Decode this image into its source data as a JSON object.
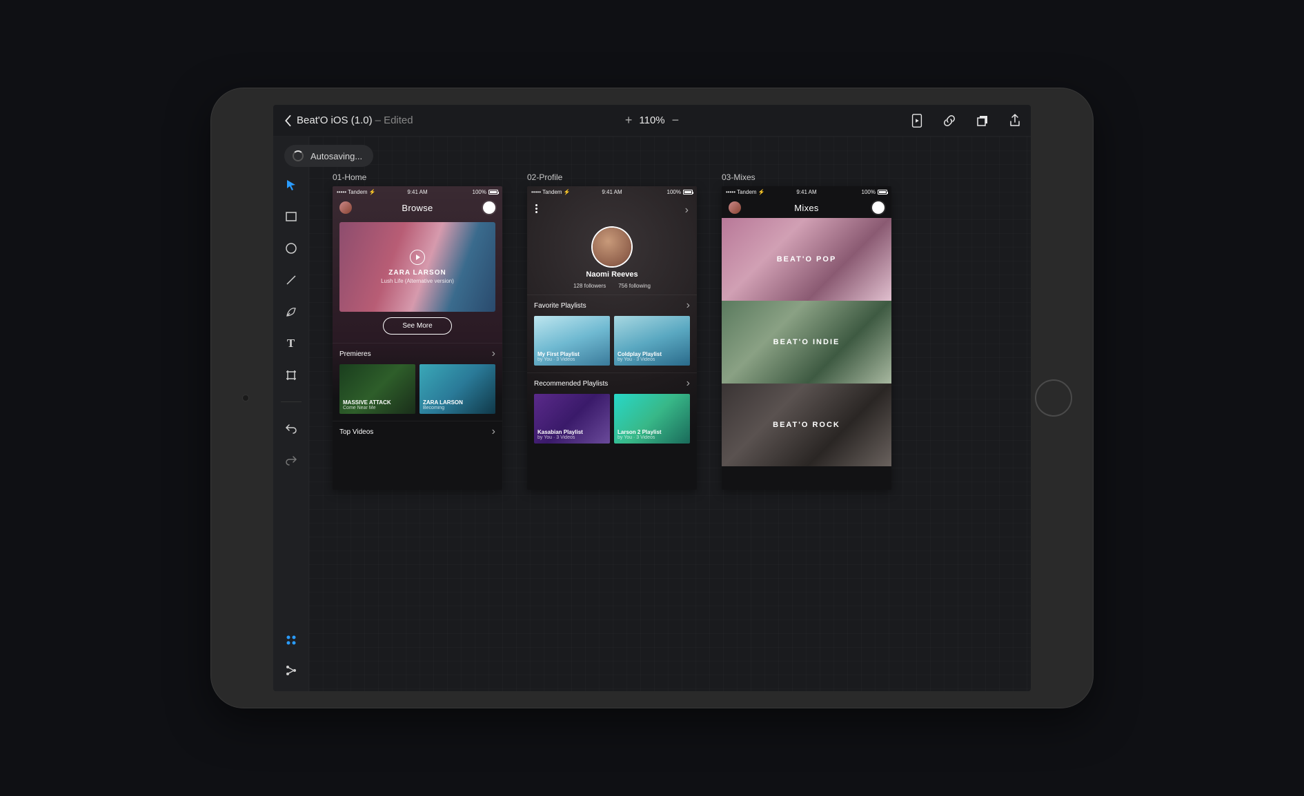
{
  "topbar": {
    "title": "Beat'O iOS (1.0)",
    "edited_suffix": " – Edited",
    "zoom": "110%"
  },
  "autosave": {
    "text": "Autosaving..."
  },
  "artboards": {
    "home": {
      "label": "01-Home",
      "status": {
        "carrier": "Tandem",
        "time": "9:41 AM",
        "battery": "100%"
      },
      "header_title": "Browse",
      "hero": {
        "artist": "ZARA LARSON",
        "track": "Lush Life (Alternative version)"
      },
      "see_more": "See More",
      "section_premieres": "Premieres",
      "premieres": [
        {
          "title": "MASSIVE ATTACK",
          "sub": "Come Near Me"
        },
        {
          "title": "ZARA LARSON",
          "sub": "Becoming"
        }
      ],
      "section_top": "Top Videos"
    },
    "profile": {
      "label": "02-Profile",
      "status": {
        "carrier": "Tandem",
        "time": "9:41 AM",
        "battery": "100%"
      },
      "name": "Naomi Reeves",
      "followers": "128 followers",
      "following": "756 following",
      "section_fav": "Favorite Playlists",
      "fav": [
        {
          "title": "My First Playlist",
          "sub": "by You · 3 Videos"
        },
        {
          "title": "Coldplay Playlist",
          "sub": "by You · 3 Videos"
        }
      ],
      "section_rec": "Recommended Playlists",
      "rec": [
        {
          "title": "Kasabian Playlist",
          "sub": "by You · 3 Videos"
        },
        {
          "title": "Larson 2 Playlist",
          "sub": "by You · 3 Videos"
        }
      ]
    },
    "mixes": {
      "label": "03-Mixes",
      "status": {
        "carrier": "Tandem",
        "time": "9:41 AM",
        "battery": "100%"
      },
      "header_title": "Mixes",
      "tiles": [
        "BEAT'O POP",
        "BEAT'O INDIE",
        "BEAT'O ROCK"
      ]
    }
  }
}
